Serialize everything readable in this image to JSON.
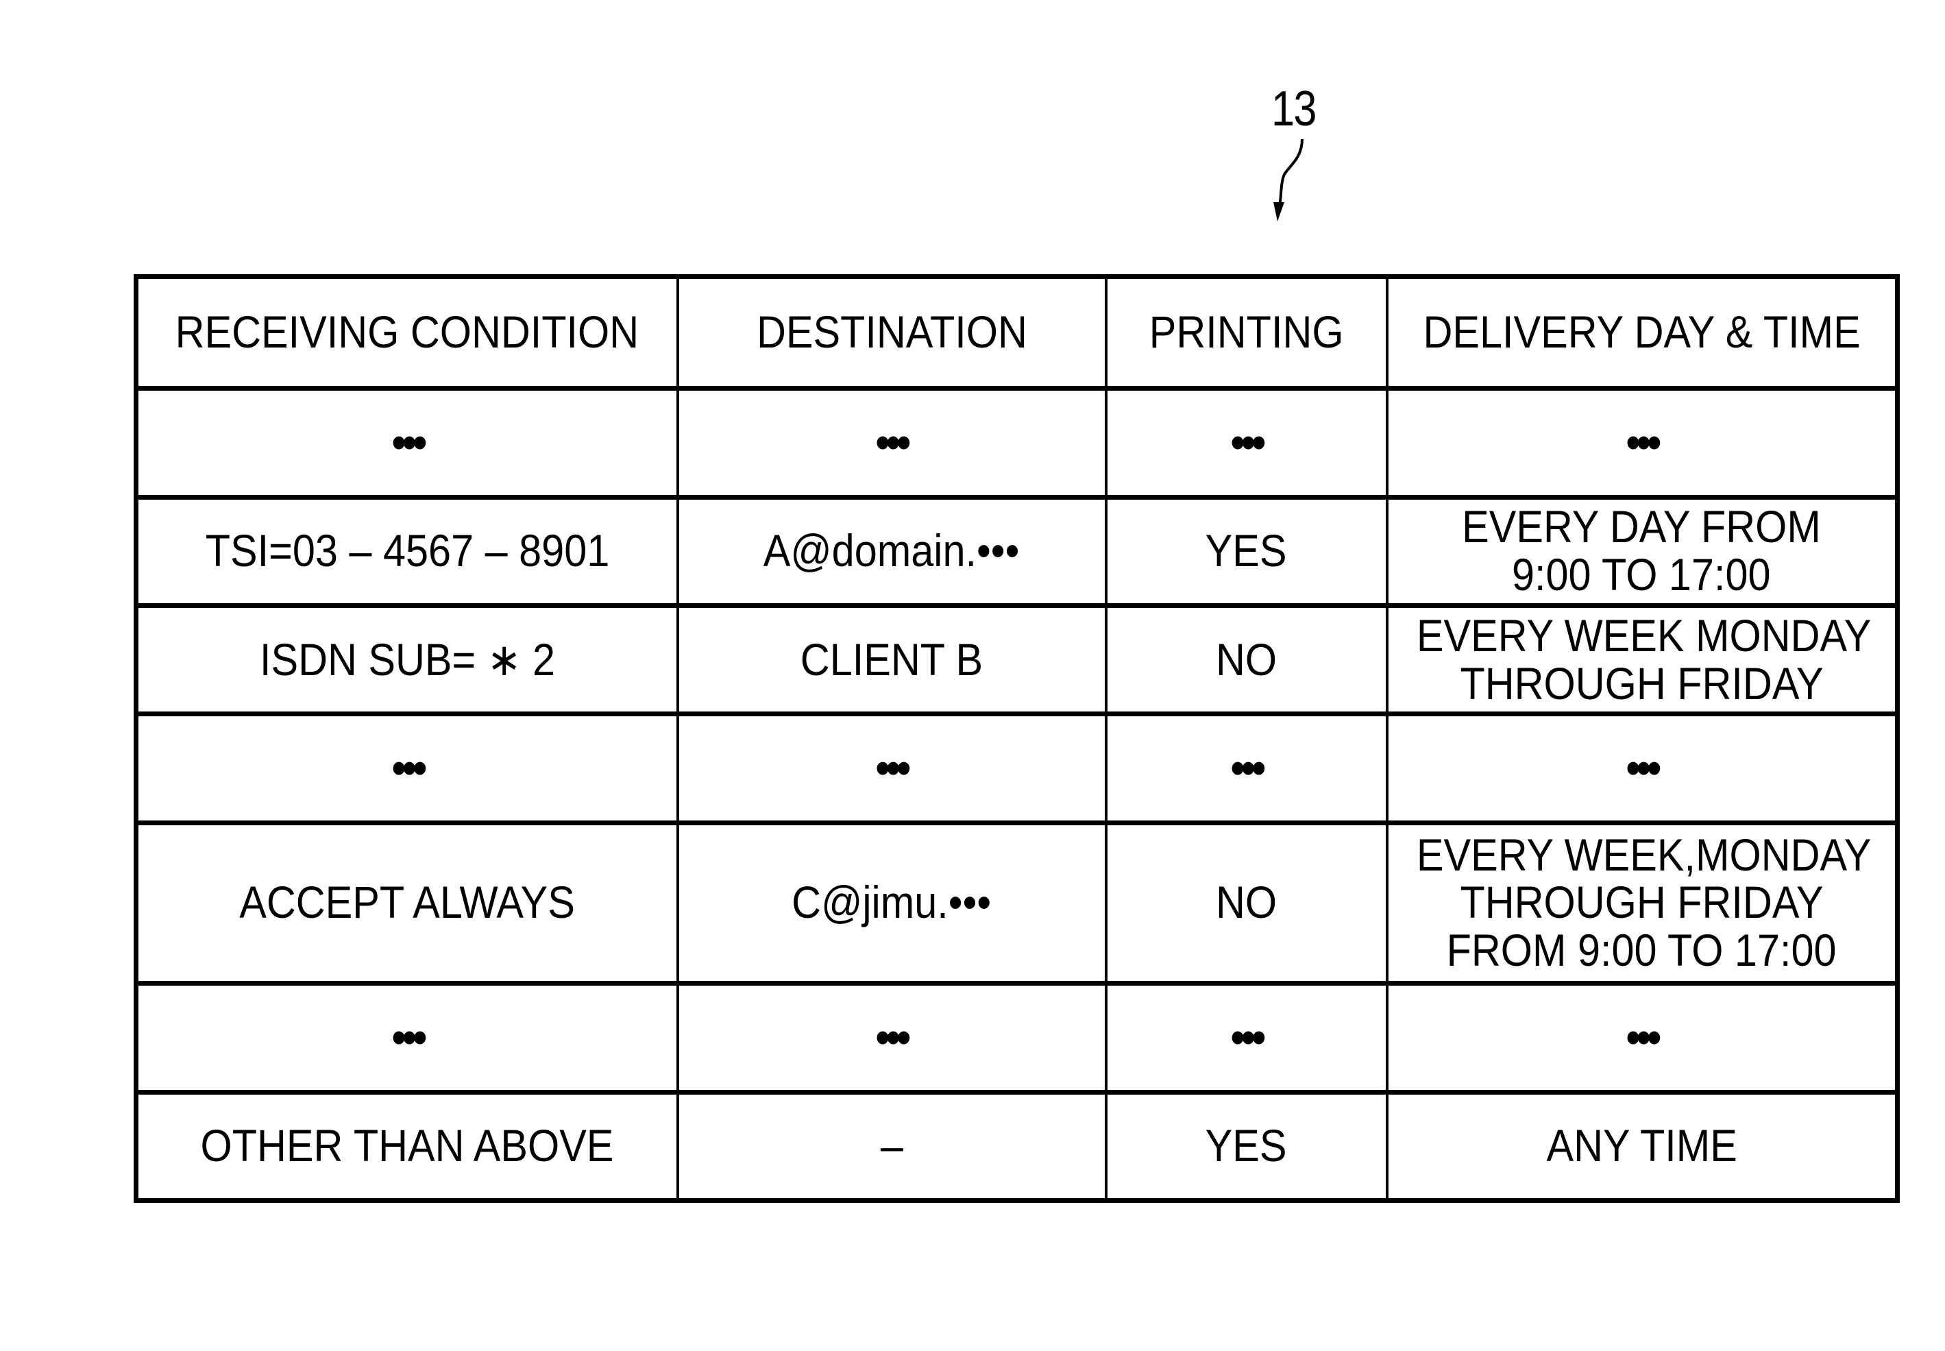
{
  "figure": {
    "reference_numeral": "13"
  },
  "table": {
    "headers": [
      "RECEIVING CONDITION",
      "DESTINATION",
      "PRINTING",
      "DELIVERY DAY & TIME"
    ],
    "rows": [
      {
        "receiving_condition": "•••",
        "destination": "•••",
        "printing": "•••",
        "delivery": [
          "•••"
        ]
      },
      {
        "receiving_condition": "TSI=03 – 4567 – 8901",
        "destination": "A@domain.•••",
        "printing": "YES",
        "delivery": [
          "EVERY DAY FROM",
          "9:00 TO 17:00"
        ]
      },
      {
        "receiving_condition": "ISDN SUB= ∗ 2",
        "destination": "CLIENT B",
        "printing": "NO",
        "delivery": [
          "EVERY WEEK MONDAY",
          "THROUGH FRIDAY"
        ]
      },
      {
        "receiving_condition": "•••",
        "destination": "•••",
        "printing": "•••",
        "delivery": [
          "•••"
        ]
      },
      {
        "receiving_condition": "ACCEPT ALWAYS",
        "destination": "C@jimu.•••",
        "printing": "NO",
        "delivery": [
          "EVERY WEEK,MONDAY",
          "THROUGH FRIDAY",
          "FROM 9:00 TO 17:00"
        ]
      },
      {
        "receiving_condition": "•••",
        "destination": "•••",
        "printing": "•••",
        "delivery": [
          "•••"
        ]
      },
      {
        "receiving_condition": "OTHER THAN ABOVE",
        "destination": "–",
        "printing": "YES",
        "delivery": [
          "ANY TIME"
        ]
      }
    ]
  }
}
